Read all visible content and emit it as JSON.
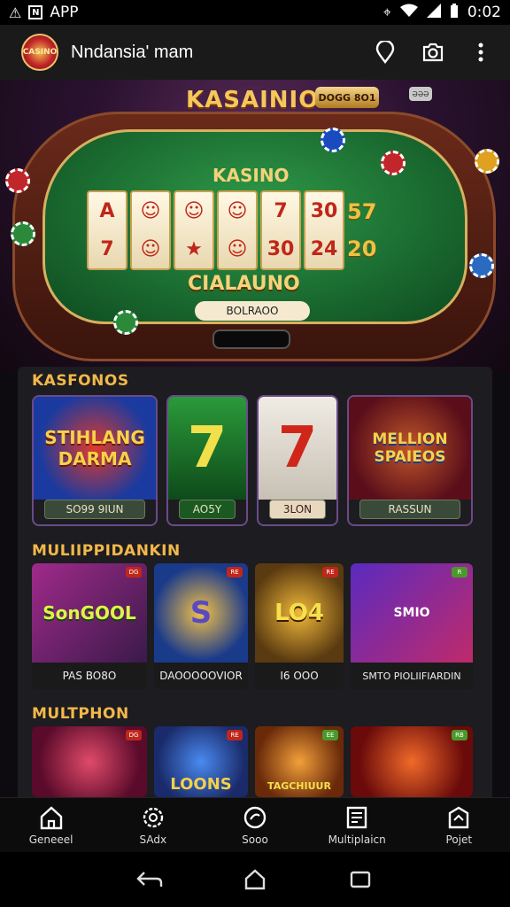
{
  "status_bar": {
    "app_label": "APP",
    "time": "0:02",
    "icons": [
      "warning-icon",
      "notification-icon",
      "location-icon",
      "wifi-icon",
      "signal-icon",
      "battery-icon"
    ]
  },
  "app_bar": {
    "title": "Nndansia' mam",
    "logo_text": "CASINO",
    "actions": [
      "location-pin-icon",
      "camera-icon",
      "more-vert-icon"
    ]
  },
  "hero": {
    "title": "KASAINIO",
    "badge": "DOGG 8O1",
    "badge2": "ƏƏƏ",
    "felt_title": "KASINO",
    "felt_subtitle": "CIALAUNO",
    "chip_bar": "BOLRAOO",
    "reels": [
      [
        "A",
        "7"
      ],
      [
        "☺",
        "☺"
      ],
      [
        "☺",
        "★"
      ],
      [
        "☺",
        "☺"
      ],
      [
        "7",
        "30"
      ],
      [
        "30",
        "24"
      ]
    ],
    "side_numbers": [
      "57",
      "20"
    ]
  },
  "sections": {
    "kasfonos": {
      "title": "KASFONOS",
      "cards": [
        {
          "art": "STIHLANG DARMA",
          "caption": "SO99 9IUN",
          "accent": "#1a3aa0"
        },
        {
          "art": "7",
          "caption": "AO5Y",
          "accent": "#1a7a30"
        },
        {
          "art": "7",
          "caption": "3LON",
          "accent": "#d8d0c8"
        },
        {
          "art": "MELLION SPAIEOS",
          "caption": "RASSUN",
          "accent": "#6a1a2a"
        }
      ]
    },
    "multiplayer": {
      "title": "MULIIPPIDANKIN",
      "cards": [
        {
          "art": "SonGOOL",
          "caption": "PAS BO8O",
          "tag": "DG",
          "accent": "#7a2a6a"
        },
        {
          "art": "S",
          "caption": "DAOOOOOVIOR",
          "tag": "RE",
          "accent": "#1a3a8a"
        },
        {
          "art": "LO4",
          "caption": "I6 OOO",
          "tag": "RE",
          "accent": "#5a3a10"
        },
        {
          "art": "SMIO",
          "caption": "SMTO PIOLIIFIARDIN",
          "tag": "R",
          "accent": "#3a1a6a"
        }
      ]
    },
    "multiphon": {
      "title": "MULTPHON",
      "cards": [
        {
          "art": "",
          "tag": "DG",
          "accent": "#7a1a3a"
        },
        {
          "art": "LOONS",
          "tag": "RE",
          "accent": "#1a3a9a"
        },
        {
          "art": "TAGCHIUUR",
          "tag": "EE",
          "accent": "#8a4a10"
        },
        {
          "art": "",
          "tag": "RB",
          "accent": "#7a1a10"
        }
      ]
    }
  },
  "bottom_nav": [
    {
      "label": "Geneeel",
      "icon": "home-icon"
    },
    {
      "label": "SAdx",
      "icon": "gear-icon"
    },
    {
      "label": "Sooo",
      "icon": "chip-icon"
    },
    {
      "label": "Multiplaicn",
      "icon": "multiplayer-icon"
    },
    {
      "label": "Pojet",
      "icon": "profile-icon"
    }
  ],
  "system_nav": [
    "back-icon",
    "home-icon",
    "recents-icon"
  ]
}
